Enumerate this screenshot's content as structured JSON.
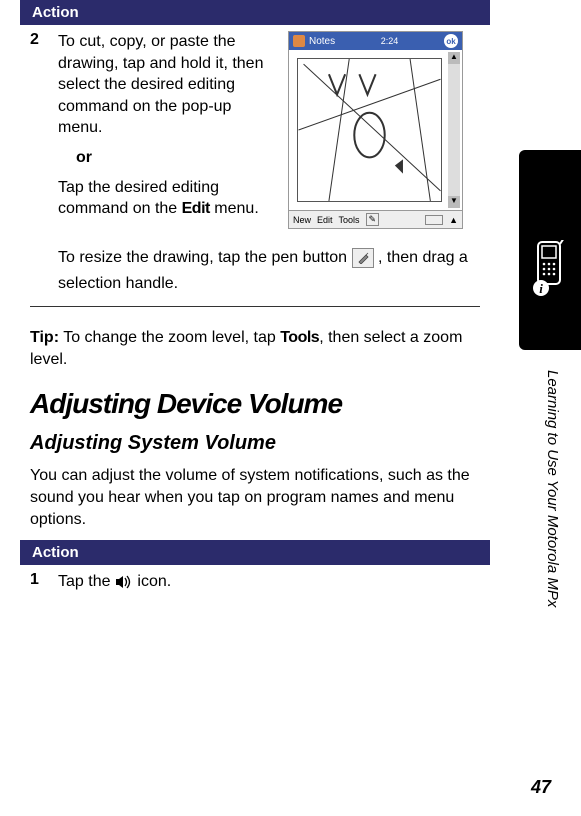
{
  "actionbar1": {
    "label": "Action"
  },
  "step2": {
    "num": "2",
    "para1": "To cut, copy, or paste the drawing, tap and hold it, then select the desired editing command on the pop-up menu.",
    "or": "or",
    "para2a": "Tap the desired editing command on the ",
    "editWord": "Edit",
    "para2b": " menu.",
    "resizeA": "To resize the drawing, tap the pen button ",
    "resizeB": ", then drag a selection handle."
  },
  "pda": {
    "title": "Notes",
    "time": "2:24",
    "ok": "ok",
    "menuNew": "New",
    "menuEdit": "Edit",
    "menuTools": "Tools"
  },
  "tip": {
    "label": "Tip:",
    "textA": " To change the zoom level, tap ",
    "tools": "Tools",
    "textB": ", then select a zoom level."
  },
  "h1": "Adjusting Device Volume",
  "h2": "Adjusting System Volume",
  "para": "You can adjust the volume of system notifications, such as the sound you hear when you tap on program names and menu options.",
  "actionbar2": {
    "label": "Action"
  },
  "step1v": {
    "num": "1",
    "textA": "Tap the ",
    "textB": " icon."
  },
  "sideText": "Learning to Use Your Motorola MPx",
  "pageNum": "47"
}
